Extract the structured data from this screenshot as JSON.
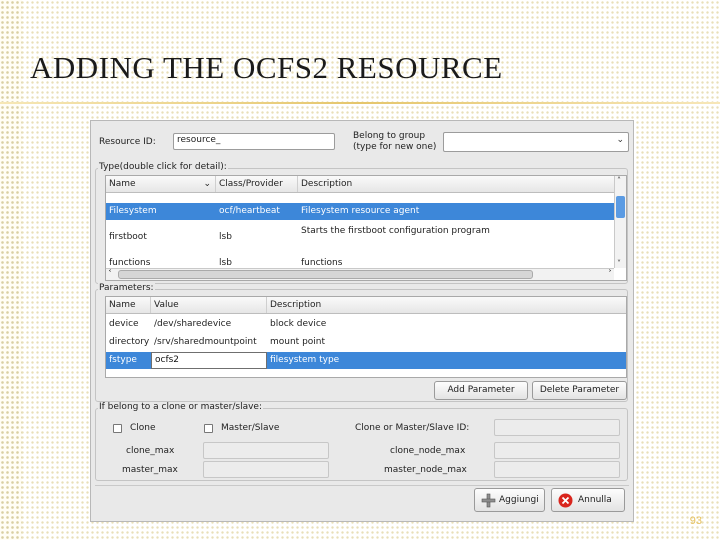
{
  "slide": {
    "title": "ADDING THE OCFS2 RESOURCE",
    "page_number": "93"
  },
  "dialog": {
    "resource_id_label": "Resource ID:",
    "resource_id_value": "resource_",
    "belong_group_label_line1": "Belong to group",
    "belong_group_label_line2": "(type for new one)",
    "belong_group_value": "",
    "type_group_title": "Type(double click for detail):",
    "type_table": {
      "headers": [
        "Name",
        "Class/Provider",
        "Description"
      ],
      "rows": [
        {
          "name": "",
          "provider": "",
          "description": ""
        },
        {
          "name": "Filesystem",
          "provider": "ocf/heartbeat",
          "description": "Filesystem resource agent"
        },
        {
          "name": "firstboot",
          "provider": "lsb",
          "description": "Starts the firstboot configuration program"
        },
        {
          "name": "functions",
          "provider": "lsb",
          "description": "functions"
        }
      ],
      "selected_index": 1
    },
    "params_group_title": "Parameters:",
    "params_table": {
      "headers": [
        "Name",
        "Value",
        "Description"
      ],
      "rows": [
        {
          "name": "device",
          "value": "/dev/sharedevice",
          "description": "block device"
        },
        {
          "name": "directory",
          "value": "/srv/sharedmountpoint",
          "description": "mount point"
        },
        {
          "name": "fstype",
          "value": "ocfs2",
          "description": "filesystem type"
        }
      ],
      "selected_index": 2
    },
    "add_parameter_label": "Add Parameter",
    "delete_parameter_label": "Delete Parameter",
    "clone_group_title": "If belong to a clone or master/slave:",
    "clone_label": "Clone",
    "master_slave_label": "Master/Slave",
    "clone_id_label": "Clone or Master/Slave ID:",
    "clone_max_label": "clone_max",
    "clone_node_max_label": "clone_node_max",
    "master_max_label": "master_max",
    "master_node_max_label": "master_node_max",
    "add_button_label": "Aggiungi",
    "cancel_button_label": "Annulla"
  },
  "colors": {
    "selection": "#3d87d9",
    "title_rule": "#e5c66c",
    "page_number": "#e6c261"
  },
  "icons": {
    "add": "plus-icon",
    "cancel": "cancel-circle-icon",
    "dropdown": "chevron-down-icon"
  }
}
